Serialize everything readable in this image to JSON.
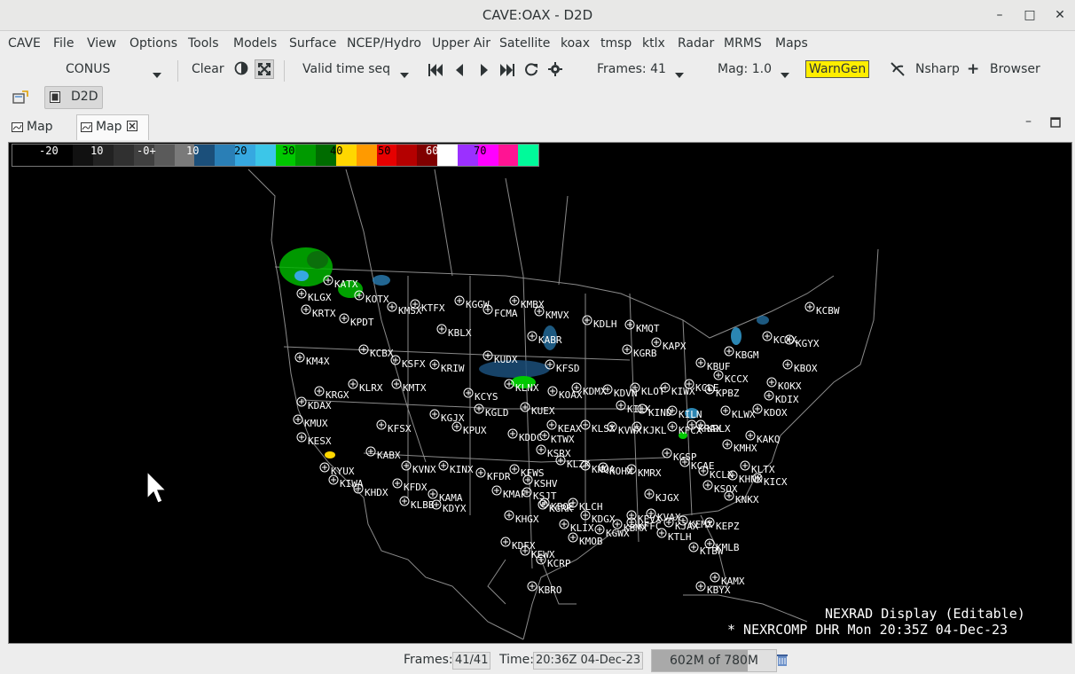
{
  "window": {
    "title": "CAVE:OAX - D2D"
  },
  "menu": [
    "CAVE",
    "File",
    "View",
    "Options",
    "Tools",
    "Models",
    "Surface",
    "NCEP/Hydro",
    "Upper Air",
    "Satellite",
    "koax",
    "tmsp",
    "ktlx",
    "Radar",
    "MRMS",
    "Maps"
  ],
  "toolbar": {
    "scale": "CONUS",
    "clear": "Clear",
    "time_mode": "Valid time seq",
    "frames": "Frames: 41",
    "mag": "Mag: 1.0",
    "warngen": "WarnGen",
    "nsharp": "Nsharp",
    "browser": "Browser"
  },
  "perspective": {
    "label": "D2D"
  },
  "tabs": [
    {
      "label": "Map"
    },
    {
      "label": "Map"
    }
  ],
  "colorbar": {
    "labels": [
      "-20",
      "10",
      "-0+",
      "10",
      "20",
      "30",
      "40",
      "50",
      "60",
      "70"
    ],
    "colors": [
      "#000000",
      "#000000",
      "#000000",
      "#111111",
      "#222222",
      "#303030",
      "#404040",
      "#5a5a5a",
      "#7a7a7a",
      "#1b4f7a",
      "#2a7fb6",
      "#36a8e0",
      "#3cc6e8",
      "#00c800",
      "#009a00",
      "#006c00",
      "#ffd700",
      "#ff9a00",
      "#e60000",
      "#b40000",
      "#800000",
      "#ffffff",
      "#9b30ff",
      "#ff00ff",
      "#ff1493",
      "#00fa9a"
    ]
  },
  "map_overlay": {
    "line1": "NEXRAD Display (Editable)",
    "line2": "* NEXRCOMP DHR   Mon 20:35Z 04-Dec-23"
  },
  "stations": [
    "KATX",
    "KLGX",
    "KOTX",
    "KRTX",
    "KMSX",
    "KTFX",
    "KGGW",
    "FCMA",
    "KMBX",
    "KPDT",
    "KBLX",
    "KMVX",
    "KDLH",
    "KMQT",
    "KCBW",
    "KCXX",
    "KGYX",
    "KABR",
    "KFSD",
    "KAPX",
    "KGRB",
    "KBUF",
    "KBGM",
    "KBOX",
    "KOKX",
    "KM4X",
    "KCBX",
    "KSFX",
    "KRIW",
    "KUDX",
    "KLNX",
    "KOAX",
    "KDMX",
    "KDVN",
    "KLOT",
    "KIWX",
    "KCLE",
    "KCCX",
    "KDIX",
    "KDOX",
    "KRGX",
    "KLRX",
    "KMTX",
    "KCYS",
    "KGLD",
    "KUEX",
    "KILX",
    "KIND",
    "KILN",
    "KRLX",
    "KPBZ",
    "KLWX",
    "KAKQ",
    "KDAX",
    "KMUX",
    "KGJX",
    "KPUX",
    "KDDC",
    "KTWX",
    "KEAX",
    "KLSX",
    "KVWX",
    "KJKL",
    "KFCX",
    "KRAX",
    "KMHX",
    "KLTX",
    "KHNX",
    "KICX",
    "KESX",
    "KFSX",
    "KABX",
    "KVNX",
    "KINX",
    "KSRX",
    "KLZK",
    "KNQA",
    "KOHX",
    "KMRX",
    "KGSP",
    "KCAE",
    "KCLX",
    "KSOX",
    "KNKX",
    "KYUX",
    "KIWA",
    "KHDX",
    "KFDX",
    "KAMA",
    "KFDR",
    "KFWS",
    "KSHV",
    "KPOE",
    "KLCH",
    "KDGX",
    "KGWX",
    "KBMX",
    "KFFC",
    "KJGX",
    "KVAX",
    "KJAX",
    "KEMX",
    "KEPZ",
    "KLBB",
    "KDYX",
    "KMAF",
    "KSJT",
    "KGRK",
    "KHGX",
    "KLIX",
    "KMOB",
    "KEVX",
    "KTLH",
    "KTBW",
    "KMLB",
    "KAMX",
    "KBYX",
    "KDFX",
    "KEWX",
    "KCRP",
    "KBRO"
  ],
  "status": {
    "frames_label": "Frames:",
    "frames_value": "41/41",
    "time_label": "Time:",
    "time_value": "20:36Z 04-Dec-23",
    "memory": "602M of 780M",
    "memory_used_fraction": 0.772
  }
}
